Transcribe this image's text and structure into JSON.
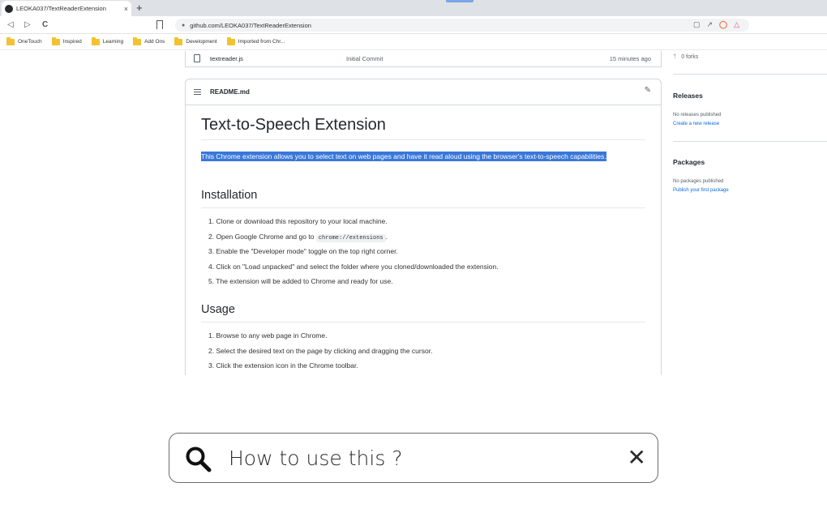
{
  "browser": {
    "tab_title": "LEOKA037/TextReaderExtension",
    "tab_close": "×",
    "new_tab": "+",
    "nav": {
      "back": "◁",
      "forward": "▷",
      "reload": "C"
    },
    "url": "github.com/LEOKA037/TextReaderExtension",
    "bookmarks": [
      "OneTouch",
      "Inspired",
      "Learning",
      "Add Ons",
      "Development",
      "Imported from Chr..."
    ]
  },
  "file_row": {
    "name": "textreader.js",
    "message": "Initial Commit",
    "time": "15 minutes ago"
  },
  "readme": {
    "filename": "README.md",
    "h1": "Text-to-Speech Extension",
    "intro": "This Chrome extension allows you to select text on web pages and have it read aloud using the browser's text-to-speech capabilities.",
    "installation": {
      "heading": "Installation",
      "steps": [
        "1. Clone or download this repository to your local machine.",
        "2. Open Google Chrome and go to",
        "3. Enable the \"Developer mode\" toggle on the top right corner.",
        "4. Click on \"Load unpacked\" and select the folder where you cloned/downloaded the extension.",
        "5. The extension will be added to Chrome and ready for use."
      ],
      "step2_code": "chrome://extensions",
      "step2_end": "."
    },
    "usage": {
      "heading": "Usage",
      "steps": [
        "1. Browse to any web page in Chrome.",
        "2. Select the desired text on the page by clicking and dragging the cursor.",
        "3. Click the extension icon in the Chrome toolbar."
      ]
    }
  },
  "sidebar": {
    "forks": "0 forks",
    "releases_heading": "Releases",
    "releases_text": "No releases published",
    "releases_link": "Create a new release",
    "packages_heading": "Packages",
    "packages_text": "No packages published",
    "packages_link": "Publish your first package"
  },
  "search": {
    "query": "How to use this ?",
    "close": "✕"
  },
  "colors": {
    "selection": "#3a78d8",
    "link": "#0969da",
    "folder": "#f2c230"
  }
}
